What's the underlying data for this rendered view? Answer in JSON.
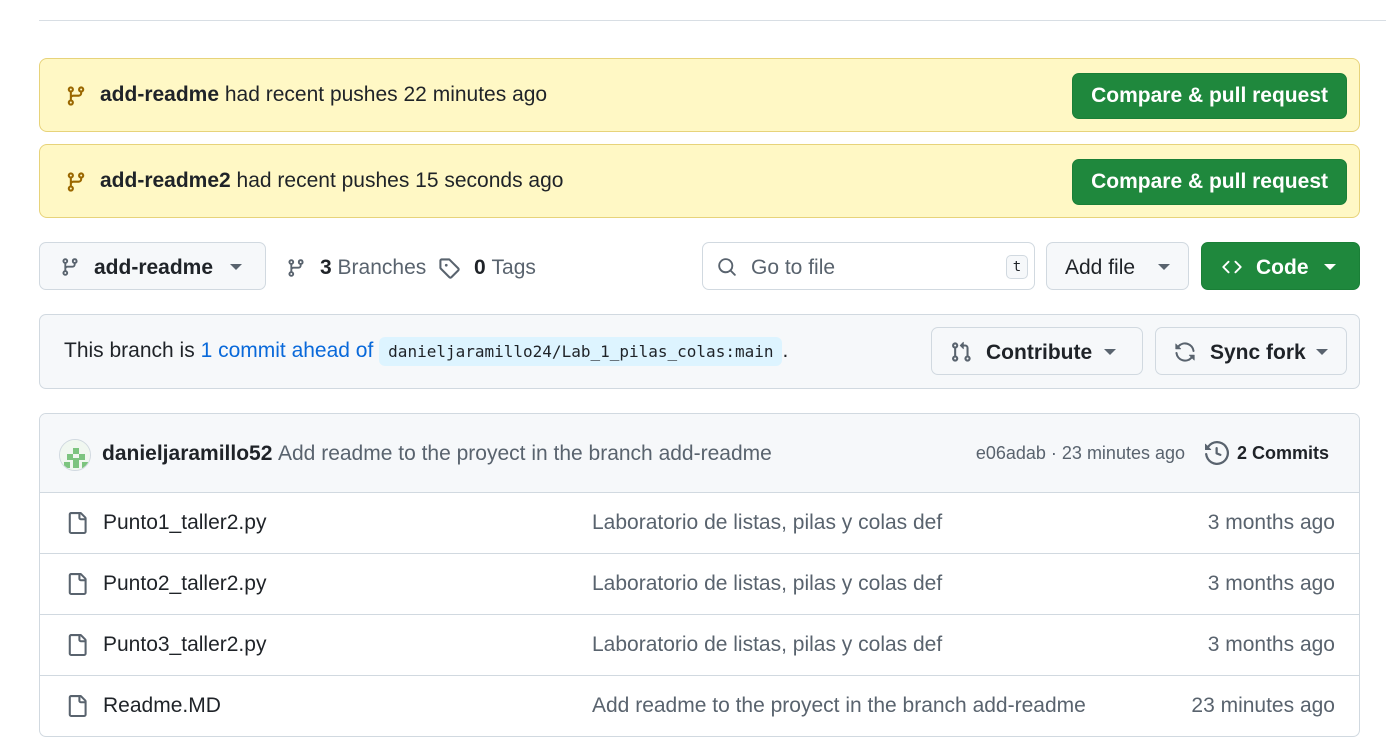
{
  "banners": [
    {
      "branch": "add-readme",
      "message": " had recent pushes 22 minutes ago",
      "button": "Compare & pull request"
    },
    {
      "branch": "add-readme2",
      "message": " had recent pushes 15 seconds ago",
      "button": "Compare & pull request"
    }
  ],
  "toolbar": {
    "branch_selector": "add-readme",
    "branches_count": "3",
    "branches_label": "Branches",
    "tags_count": "0",
    "tags_label": "Tags",
    "search_placeholder": "Go to file",
    "search_shortcut": "t",
    "add_file": "Add file",
    "code": "Code"
  },
  "ahead": {
    "prefix": "This branch is ",
    "link": "1 commit ahead of",
    "ref": "danieljaramillo24/Lab_1_pilas_colas:main",
    "suffix": ".",
    "contribute": "Contribute",
    "sync_fork": "Sync fork"
  },
  "latest_commit": {
    "author": "danieljaramillo52",
    "message": "Add readme to the proyect in the branch add-readme",
    "meta": "e06adab · 23 minutes ago",
    "commits": "2 Commits"
  },
  "files": [
    {
      "name": "Punto1_taller2.py",
      "message": "Laboratorio de listas, pilas y colas def",
      "age": "3 months ago"
    },
    {
      "name": "Punto2_taller2.py",
      "message": "Laboratorio de listas, pilas y colas def",
      "age": "3 months ago"
    },
    {
      "name": "Punto3_taller2.py",
      "message": "Laboratorio de listas, pilas y colas def",
      "age": "3 months ago"
    },
    {
      "name": "Readme.MD",
      "message": "Add readme to the proyect in the branch add-readme",
      "age": "23 minutes ago"
    }
  ],
  "colors": {
    "green": "#1f883d",
    "banner_bg": "#fff8c5",
    "link": "#0969da",
    "branch_icon": "#9a6700"
  }
}
